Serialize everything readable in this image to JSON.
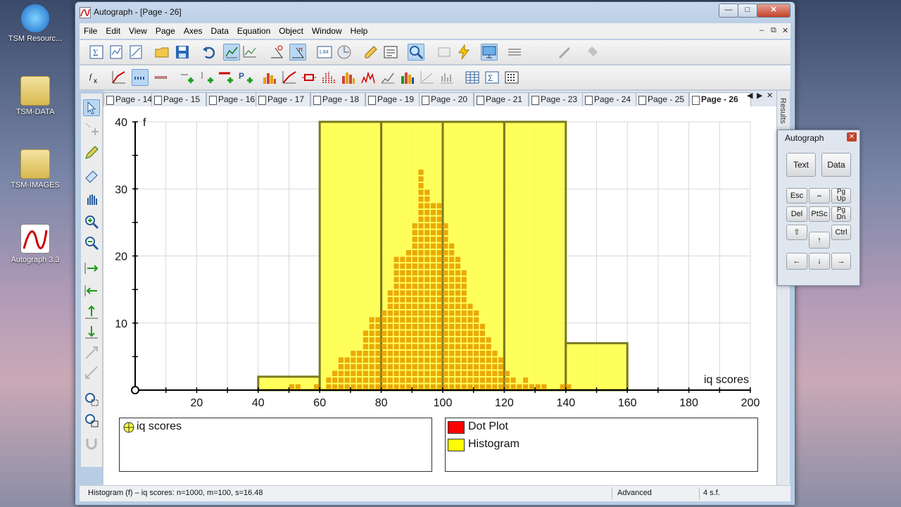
{
  "desktop": {
    "icons": [
      {
        "label": "TSM Resourc..."
      },
      {
        "label": "TSM-DATA"
      },
      {
        "label": "TSM-IMAGES"
      },
      {
        "label": "Autograph 3.3"
      }
    ]
  },
  "window": {
    "title": "Autograph - [Page - 26]",
    "controls": {
      "minimize": "—",
      "maximize": "□",
      "close": "✕"
    }
  },
  "menu": {
    "items": [
      "File",
      "Edit",
      "View",
      "Page",
      "Axes",
      "Data",
      "Equation",
      "Object",
      "Window",
      "Help"
    ],
    "mdi": {
      "minimize": "–",
      "restore": "⧉",
      "close": "✕"
    }
  },
  "tabs": {
    "items": [
      "Page - 14",
      "Page - 15",
      "Page - 16",
      "Page - 17",
      "Page - 18",
      "Page - 19",
      "Page - 20",
      "Page - 21",
      "Page - 23",
      "Page - 24",
      "Page - 25",
      "Page - 26"
    ],
    "active": "Page - 26",
    "nav": {
      "prev": "◀",
      "next": "▶",
      "close": "✕"
    }
  },
  "results_panel": {
    "label": "Results"
  },
  "chart_data": {
    "type": "bar",
    "kind": "histogram",
    "xlabel": "iq scores",
    "ylabel": "f",
    "xlim": [
      0,
      200
    ],
    "ylim": [
      0,
      40
    ],
    "x_ticks": [
      20,
      40,
      60,
      80,
      100,
      120,
      140,
      160,
      180,
      200
    ],
    "y_ticks": [
      10,
      20,
      30,
      40
    ],
    "grid": true,
    "histogram": {
      "color": "#ffff40",
      "edge_color": "#7a7a20",
      "bins": [
        {
          "from": 40,
          "to": 60,
          "value": 2
        },
        {
          "from": 60,
          "to": 80,
          "value": 40
        },
        {
          "from": 80,
          "to": 100,
          "value": 40
        },
        {
          "from": 100,
          "to": 120,
          "value": 40
        },
        {
          "from": 120,
          "to": 140,
          "value": 40
        },
        {
          "from": 140,
          "to": 160,
          "value": 7
        }
      ]
    },
    "dot_plot": {
      "color": "#e8a000",
      "column_width": 2,
      "x_start": 50,
      "counts": [
        1,
        1,
        0,
        0,
        1,
        0,
        2,
        3,
        5,
        5,
        6,
        6,
        9,
        11,
        11,
        12,
        15,
        20,
        20,
        21,
        25,
        33,
        30,
        28,
        28,
        25,
        22,
        20,
        18,
        13,
        12,
        10,
        8,
        6,
        5,
        3,
        2,
        1,
        2,
        1,
        1,
        1,
        0,
        0,
        1,
        1,
        0,
        0,
        0,
        0,
        0
      ]
    }
  },
  "legends": {
    "left": [
      {
        "label": "iq scores",
        "icon": "crosshair-point-icon"
      }
    ],
    "right": [
      {
        "label": "Dot Plot",
        "color": "#ff0000"
      },
      {
        "label": "Histogram",
        "color": "#ffff00"
      }
    ]
  },
  "status": {
    "main": "Histogram (f) – iq scores: n=1000, m=100, s=16.48",
    "mode": "Advanced",
    "precision": "4 s.f."
  },
  "keypad": {
    "title": "Autograph",
    "close": "✕",
    "buttons": {
      "text": "Text",
      "data": "Data",
      "esc": "Esc",
      "hat": "⌢",
      "pgup": "Pg Up",
      "del": "Del",
      "ptsc": "PtSc",
      "pgdn": "Pg Dn",
      "shift": "⇧",
      "up": "↑",
      "ctrl": "Ctrl",
      "left": "←",
      "down": "↓",
      "right": "→"
    }
  }
}
